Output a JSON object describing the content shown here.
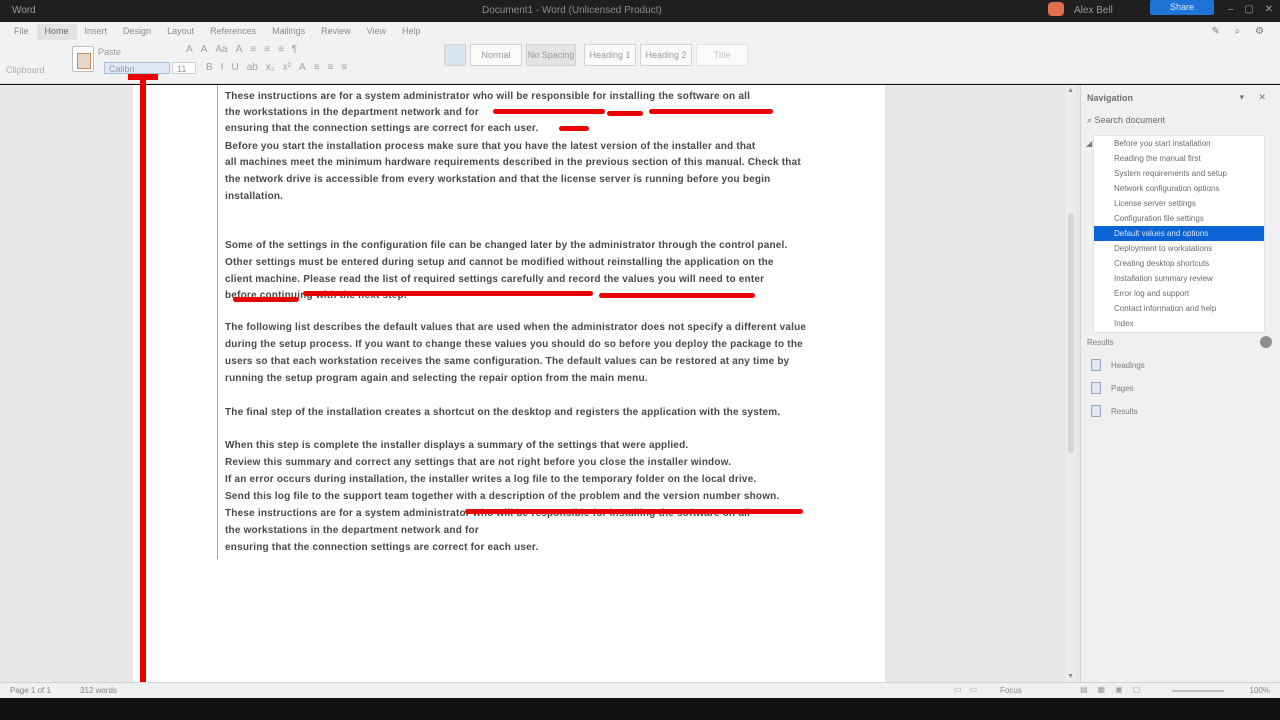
{
  "titlebar": {
    "app": "Word",
    "title": "Document1 - Word (Unlicensed Product)",
    "user": "Alex Bell",
    "share": "Share",
    "window_controls": "–  ▢  ✕"
  },
  "ribbon": {
    "tabs": [
      "File",
      "Home",
      "Insert",
      "Design",
      "Layout",
      "References",
      "Mailings",
      "Review",
      "View",
      "Help"
    ],
    "active_tab_index": 1,
    "paste_label": "Paste",
    "clipboard_label": "Clipboard",
    "font_name": "Calibri",
    "font_size": "11",
    "style_normal": "Normal",
    "style_no_spacing": "No Spacing",
    "style_heading1": "Heading 1",
    "style_heading2": "Heading 2",
    "style_title": "Title",
    "right_tools": "✎  ⌕  ⚙",
    "row1_icons": [
      "A",
      "A",
      "Aa",
      "A",
      "≡",
      "≡",
      "≡",
      "¶"
    ],
    "row2_icons": [
      "B",
      "I",
      "U",
      "ab",
      "x₂",
      "x²",
      "A",
      "≡",
      "≡",
      "≡"
    ]
  },
  "document": {
    "lines": [
      "These instructions are for a system administrator who will be responsible for installing the software on all",
      "the workstations in the department network and for",
      "ensuring that the connection settings are correct for each user.",
      "Before you start the installation process make sure that you have the latest version of the installer and that",
      "all machines meet the minimum hardware requirements described in the previous section of this manual. Check that",
      "the network drive is accessible from every workstation and that the license server is running before you begin",
      "installation.",
      "",
      "Some of the settings in the configuration file can be changed later by the administrator through the control panel.",
      "Other settings must be entered during setup and cannot be modified without reinstalling the application on the",
      "client machine. Please read the list of required settings carefully and record the values you will need to enter",
      "before continuing with the next step.",
      "",
      "The following list describes the default values that are used when the administrator does not specify a different value",
      "during the setup process. If you want to change these values you should do so before you deploy the package to the",
      "users so that each workstation receives the same configuration. The default values can be restored at any time by",
      "running the setup program again and selecting the repair option from the main menu.",
      "",
      "The final step of the installation creates a shortcut on the desktop and registers the application with the system.",
      "When this step is complete the installer displays a summary of the settings that were applied.",
      "Review this summary and correct any settings that are not right before you close the installer window.",
      "If an error occurs during installation, the installer writes a log file to the temporary folder on the local drive.",
      "Send this log file to the support team together with a description of the problem and the version number shown."
    ]
  },
  "pane": {
    "title": "Navigation",
    "search": "Search document",
    "items": [
      "Before you start installation",
      "Reading the manual first",
      "System requirements and setup",
      "Network configuration options",
      "License server settings",
      "Configuration file settings",
      "Default values and options",
      "Deployment to workstations",
      "Creating desktop shortcuts",
      "Installation summary review",
      "Error log and support",
      "Contact information and help",
      "Index"
    ],
    "selected_index": 6,
    "section_title": "Results",
    "actions": [
      "Headings",
      "Pages",
      "Results"
    ]
  },
  "status": {
    "page": "Page 1 of 1",
    "words": "312 words",
    "zoom_label": "Focus",
    "zoom_pct": "100%"
  },
  "colors": {
    "accent": "#1e73d6",
    "annotation_red": "#ea0000",
    "selection": "#0b63d6"
  }
}
